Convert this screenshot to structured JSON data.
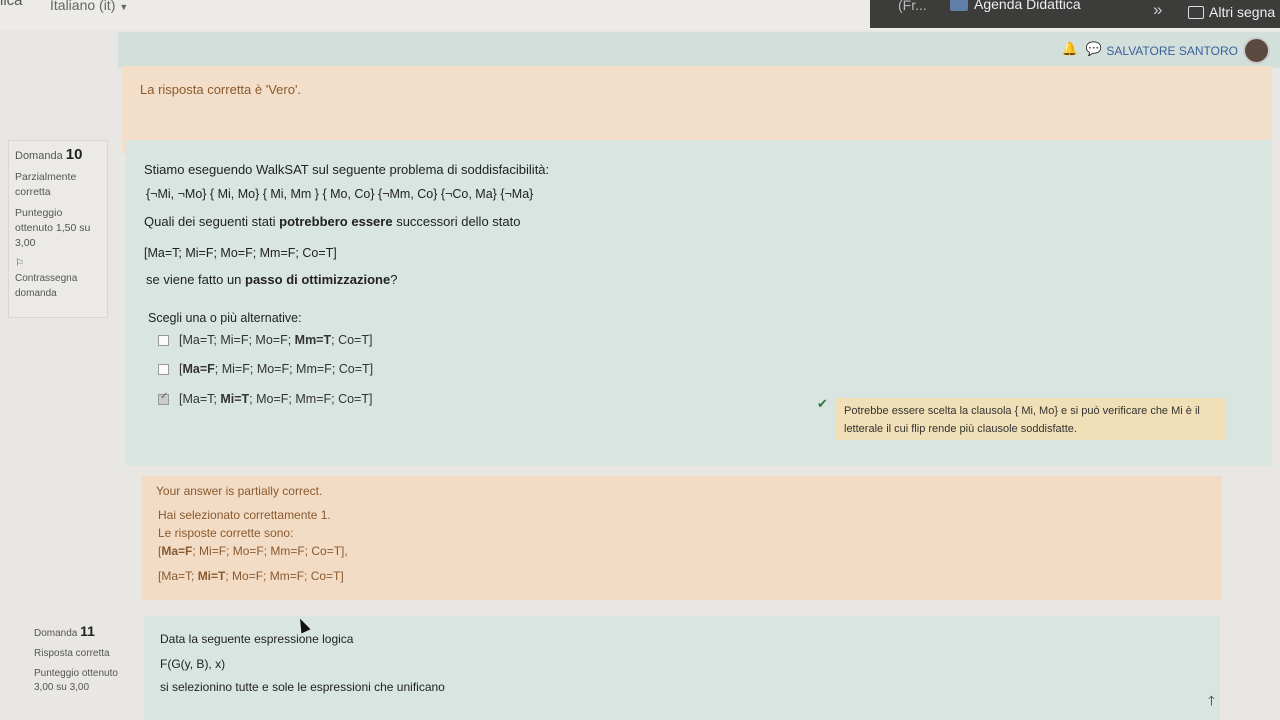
{
  "topbar": {
    "brand": "lica",
    "language": "Italiano (it)"
  },
  "tabs": {
    "ellipsis": "(Fr...",
    "agenda": "Agenda Didattica",
    "other": "Altri segna"
  },
  "header": {
    "username": "SALVATORE SANTORO"
  },
  "previous_feedback": "La risposta corretta è 'Vero'.",
  "question10": {
    "label": "Domanda",
    "number": "10",
    "state": "Parzialmente corretta",
    "points": "Punteggio ottenuto 1,50 su 3,00",
    "flag": "Contrassegna domanda",
    "intro": "Stiamo eseguendo WalkSAT sul seguente problema di soddisfacibilità:",
    "clauses": "{¬Mi, ¬Mo}  { Mi, Mo}  { Mi, Mm }  { Mo, Co}  {¬Mm, Co} {¬Co, Ma} {¬Ma}",
    "q_pre": "Quali dei seguenti stati ",
    "q_bold": "potrebbero essere",
    "q_post": " successori dello stato",
    "state_line": "[Ma=T; Mi=F; Mo=F; Mm=F; Co=T]",
    "step_pre": "se viene fatto un ",
    "step_bold": "passo di ottimizzazione",
    "step_post": "?",
    "choose": "Scegli una o più alternative:",
    "options": [
      {
        "pre": "[Ma=T; Mi=F; Mo=F; ",
        "bold": "Mm=T",
        "post": "; Co=T]",
        "checked": false
      },
      {
        "pre": "[",
        "bold": "Ma=F",
        "post": "; Mi=F; Mo=F; Mm=F; Co=T]",
        "checked": false
      },
      {
        "pre": "[Ma=T; ",
        "bold": "Mi=T",
        "post": "; Mo=F; Mm=F; Co=T]",
        "checked": true
      }
    ],
    "specific_feedback": "Potrebbe essere scelta la clausola { Mi, Mo}  e si può verificare che Mi è il letterale il cui flip rende più clausole soddisfatte."
  },
  "outcome": {
    "status": "Your answer is partially correct.",
    "selected": "Hai selezionato correttamente 1.",
    "correct_label": "Le risposte corrette sono:",
    "ans1_pre": "[",
    "ans1_bold": "Ma=F",
    "ans1_post": "; Mi=F; Mo=F; Mm=F; Co=T],",
    "ans2_pre": "[Ma=T; ",
    "ans2_bold": "Mi=T",
    "ans2_post": "; Mo=F; Mm=F; Co=T]"
  },
  "question11": {
    "label": "Domanda",
    "number": "11",
    "state": "Risposta corretta",
    "points": "Punteggio ottenuto 3,00 su 3,00",
    "line1": "Data la seguente espressione logica",
    "line2": "F(G(y, B), x)",
    "line3": "si selezionino tutte e sole le espressioni che unificano"
  }
}
